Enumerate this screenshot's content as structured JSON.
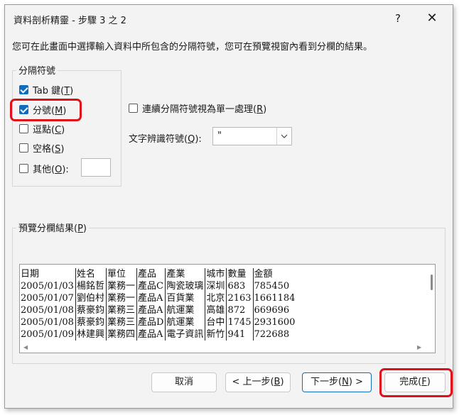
{
  "window": {
    "title": "資料剖析精靈 - 步驟 3 之 2",
    "help_label": "?",
    "close_label": "✕"
  },
  "instruction": "您可在此畫面中選擇輸入資料中所包含的分隔符號，您可在預覽視窗內看到分欄的結果。",
  "delimiters": {
    "group_label": "分隔符號",
    "tab": {
      "text": "Tab 鍵(",
      "key": "T",
      "end": ")",
      "checked": true
    },
    "semicolon": {
      "text": "分號(",
      "key": "M",
      "end": ")",
      "checked": true
    },
    "comma": {
      "text": "逗點(",
      "key": "C",
      "end": ")",
      "checked": false
    },
    "space": {
      "text": "空格(",
      "key": "S",
      "end": ")",
      "checked": false
    },
    "other": {
      "text": "其他(",
      "key": "O",
      "end": "):",
      "checked": false
    }
  },
  "consecutive": {
    "text": "連續分隔符號視為單一處理(",
    "key": "R",
    "end": ")",
    "checked": false
  },
  "qualifier": {
    "text": "文字辨識符號(",
    "key": "Q",
    "end": "):",
    "value": "\""
  },
  "preview": {
    "group_label_text": "預覽分欄結果(",
    "group_label_key": "P",
    "group_label_end": ")",
    "rows": [
      [
        "日期",
        "姓名",
        "單位",
        "產品",
        "產業",
        "城市",
        "數量",
        "金額"
      ],
      [
        "2005/01/03",
        "楊銘哲",
        "業務一",
        "產品C",
        "陶瓷玻璃",
        "深圳",
        "683",
        "785450"
      ],
      [
        "2005/01/07",
        "劉伯村",
        "業務一",
        "產品A",
        "百貨業",
        "北京",
        "2163",
        "1661184"
      ],
      [
        "2005/01/08",
        "蔡豪鈞",
        "業務三",
        "產品A",
        "航運業",
        "高雄",
        "872",
        "669696"
      ],
      [
        "2005/01/08",
        "蔡豪鈞",
        "業務三",
        "產品D",
        "航運業",
        "台中",
        "1745",
        "2931600"
      ],
      [
        "2005/01/09",
        "林建興",
        "業務四",
        "產品A",
        "電子資訊",
        "新竹",
        "941",
        "722688"
      ]
    ]
  },
  "buttons": {
    "cancel": "取消",
    "back_text": "< 上一步(",
    "back_key": "B",
    "back_end": ")",
    "next_text": "下一步(",
    "next_key": "N",
    "next_end": ") >",
    "finish_text": "完成(",
    "finish_key": "F",
    "finish_end": ")"
  },
  "colors": {
    "accent": "#0f6cbd",
    "highlight": "#e0101a",
    "dialog_bg": "#f3f3f3"
  }
}
